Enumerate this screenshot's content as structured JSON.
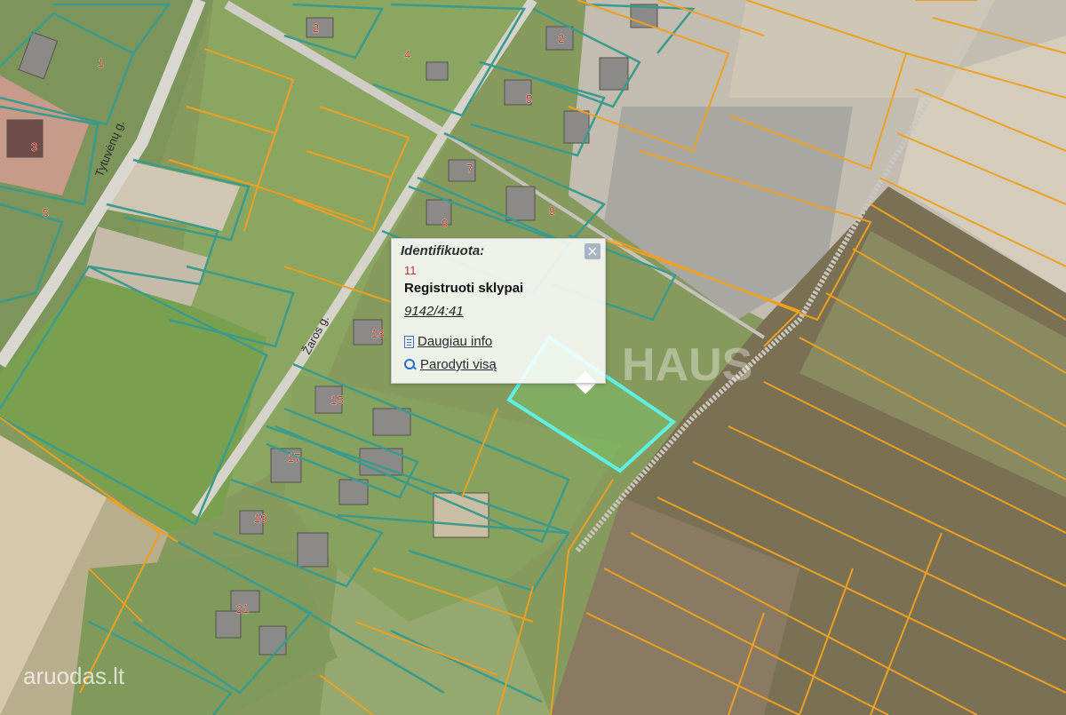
{
  "map": {
    "street_labels": [
      "Tytuvėnų g.",
      "Žaros g."
    ],
    "house_numbers": [
      "2",
      "4",
      "2",
      "1",
      "5",
      "3",
      "5",
      "9",
      "7",
      "9",
      "13",
      "15",
      "17",
      "19",
      "21"
    ],
    "colors": {
      "registered_parcel_line": "#3a9a8c",
      "parcel_line": "#f0a020",
      "selected_parcel_line": "#5ef0e4",
      "road": "#d8d8d8"
    }
  },
  "popup": {
    "title": "Identifikuota:",
    "index": "11",
    "layer": "Registruoti sklypai",
    "parcel_id": "9142/4:41",
    "more_info": "Daugiau info",
    "show_all": "Parodyti visą",
    "close_symbol": "×"
  },
  "watermarks": {
    "center": "HAUS",
    "corner": "aruodas.lt"
  }
}
